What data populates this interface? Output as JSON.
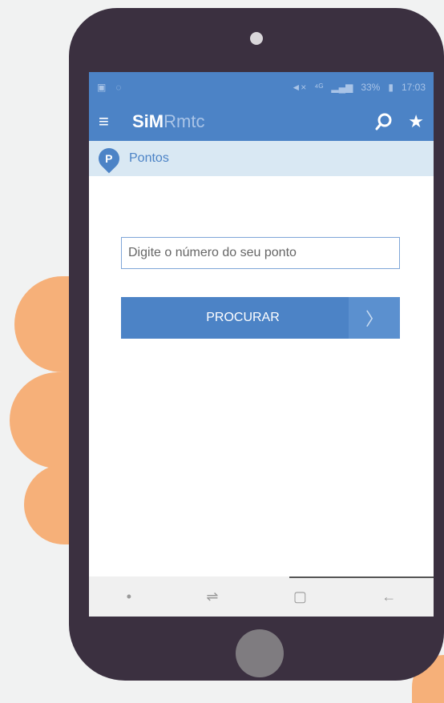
{
  "status_bar": {
    "left_icons": [
      "gallery-icon",
      "whatsapp-icon"
    ],
    "network": "⁴ᴳ",
    "signal": "📶",
    "battery": "33%",
    "time": "17:03"
  },
  "app_bar": {
    "logo_bold": "SiM",
    "logo_light": "Rmtc",
    "menu_icon": "≡",
    "search_icon": "⚲",
    "favorites_icon": "★"
  },
  "section": {
    "icon_letter": "P",
    "title": "Pontos"
  },
  "search": {
    "placeholder": "Digite o número do seu ponto",
    "button_label": "PROCURAR",
    "button_chevron": "〉"
  },
  "nav_bar": {
    "dot": "•",
    "recent": "⇌",
    "home": "▢",
    "back": "←"
  }
}
